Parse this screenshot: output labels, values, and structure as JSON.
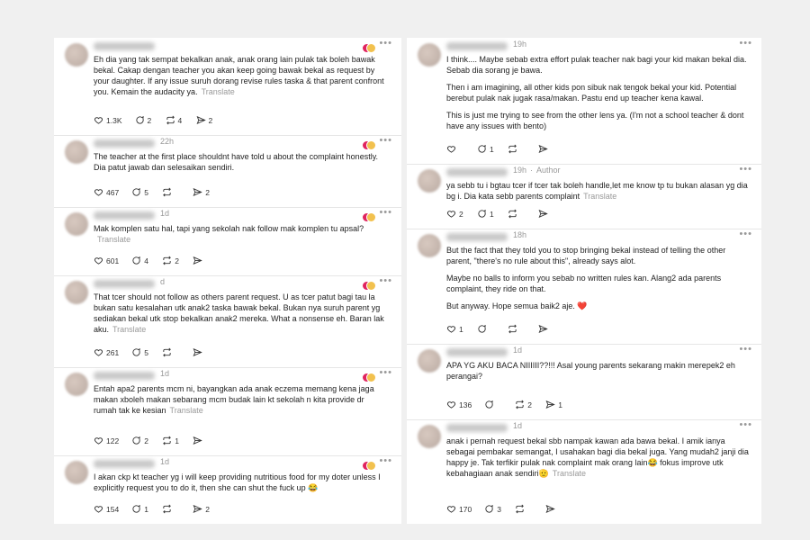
{
  "ui": {
    "translate": "Translate"
  },
  "left": [
    {
      "time": "",
      "author_tag": "",
      "lines": [
        "Eh dia yang tak sempat bekalkan anak, anak orang lain pulak tak boleh bawak bekal. Cakap dengan teacher you akan keep going bawak bekal as request by your daughter. If any issue suruh dorang revise rules taska & that parent confront you. Kemain the audacity ya."
      ],
      "translate": true,
      "likes": "1.3K",
      "replies": "2",
      "reposts": "4",
      "shares": "2"
    },
    {
      "time": "22h",
      "author_tag": "",
      "lines": [
        "The teacher at the first place shouldnt have told u about the complaint honestly. Dia patut jawab dan selesaikan sendiri."
      ],
      "translate": false,
      "likes": "467",
      "replies": "5",
      "reposts": "",
      "shares": "2"
    },
    {
      "time": "1d",
      "author_tag": "",
      "lines": [
        "Mak komplen satu hal, tapi yang sekolah nak follow mak komplen tu apsal?"
      ],
      "translate": true,
      "likes": "601",
      "replies": "4",
      "reposts": "2",
      "shares": ""
    },
    {
      "time": "d",
      "author_tag": "",
      "lines": [
        "That tcer should not follow as others parent request. U as tcer patut bagi tau la bukan satu kesalahan utk anak2 taska bawak bekal. Bukan nya suruh parent yg sediakan bekal utk stop bekalkan anak2 mereka. What a nonsense eh. Baran lak aku."
      ],
      "translate": true,
      "likes": "261",
      "replies": "5",
      "reposts": "",
      "shares": ""
    },
    {
      "time": "1d",
      "author_tag": "",
      "lines": [
        "Entah apa2 parents mcm ni, bayangkan ada anak eczema memang kena jaga makan xboleh makan sebarang mcm budak lain kt sekolah n kita provide dr rumah tak ke kesian"
      ],
      "translate": true,
      "likes": "122",
      "replies": "2",
      "reposts": "1",
      "shares": ""
    },
    {
      "time": "1d",
      "author_tag": "",
      "lines": [
        "I akan ckp kt teacher yg i will keep providing nutritious food for my doter unless I explicitly request you to do it, then she can shut the fuck up 😂"
      ],
      "translate": false,
      "likes": "154",
      "replies": "1",
      "reposts": "",
      "shares": "2"
    }
  ],
  "right": [
    {
      "time": "19h",
      "author_tag": "",
      "lines": [
        "I think.... Maybe sebab extra effort pulak teacher nak bagi your kid makan bekal dia. Sebab dia sorang je bawa.",
        "Then i am imagining, all other kids pon sibuk nak tengok bekal your kid. Potential berebut pulak nak jugak rasa/makan. Pastu end up teacher kena kawal.",
        "This is just me trying to see from the other lens ya. (I'm not a school teacher & dont have any issues with bento)"
      ],
      "translate": false,
      "likes": "",
      "replies": "1",
      "reposts": "",
      "shares": ""
    },
    {
      "time": "19h",
      "author_tag": "Author",
      "lines": [
        "ya sebb tu i bgtau tcer if tcer tak boleh handle,let me know tp tu bukan alasan yg dia bg i. Dia kata sebb parents complaint"
      ],
      "translate": true,
      "likes": "2",
      "replies": "1",
      "reposts": "",
      "shares": ""
    },
    {
      "time": "18h",
      "author_tag": "",
      "lines": [
        "But the fact that they told you to stop bringing bekal instead of telling the other parent, \"there's no rule about this\", already says alot.",
        "Maybe no balls to inform you sebab no written rules kan. Alang2 ada parents complaint, they ride on that.",
        "But anyway. Hope semua baik2 aje. ❤️"
      ],
      "translate": false,
      "likes": "1",
      "replies": "",
      "reposts": "",
      "shares": ""
    },
    {
      "time": "1d",
      "author_tag": "",
      "lines": [
        "APA YG AKU BACA NIIIIII??!!! Asal young parents sekarang makin merepek2 eh perangai?"
      ],
      "translate": false,
      "likes": "136",
      "replies": "",
      "reposts": "2",
      "shares": "1"
    },
    {
      "time": "1d",
      "author_tag": "",
      "lines": [
        "anak i pernah request bekal sbb nampak kawan ada bawa bekal. I amik ianya sebagai pembakar semangat, I usahakan bagi dia bekal juga. Yang mudah2 janji dia happy je. Tak terfikir pulak nak complaint mak orang lain😂 fokus improve utk kebahagiaan anak sendiri🫡"
      ],
      "translate": true,
      "likes": "170",
      "replies": "3",
      "reposts": "",
      "shares": ""
    }
  ]
}
